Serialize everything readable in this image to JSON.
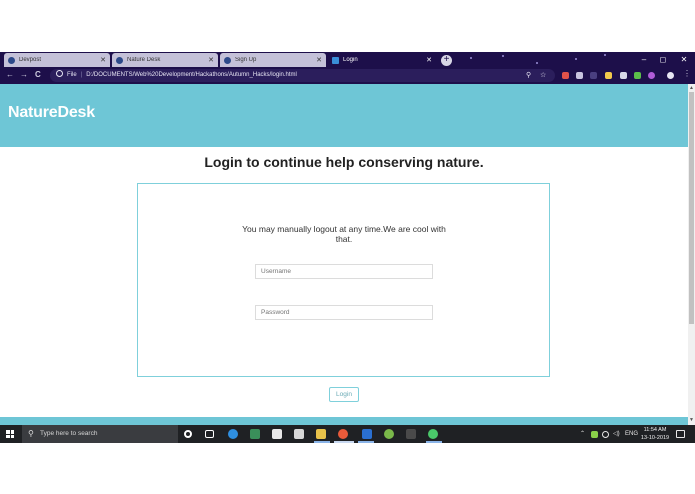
{
  "browser": {
    "tabs": [
      {
        "label": "Devpost",
        "active": false
      },
      {
        "label": "Nature Desk",
        "active": false
      },
      {
        "label": "Sign Up",
        "active": false
      },
      {
        "label": "Login",
        "active": true
      }
    ],
    "new_tab_label": "+",
    "window_controls": {
      "minimize": "–",
      "maximize": "◻",
      "close": "✕"
    },
    "nav": {
      "back": "←",
      "forward": "→",
      "reload": "C"
    },
    "address": {
      "scheme_label": "File",
      "separator": "|",
      "url": "D:/DOCUMENTS/Web%20Development/Hackathons/Autumn_Hacks/login.html"
    }
  },
  "page": {
    "brand": "NatureDesk",
    "headline": "Login to continue help conserving nature.",
    "message": "You may manually logout at any time.We are cool with that.",
    "username": {
      "value": "",
      "placeholder": "Username"
    },
    "password": {
      "value": "",
      "placeholder": "Password"
    },
    "login_label": "Login"
  },
  "taskbar": {
    "search_placeholder": "Type here to search",
    "tray": {
      "language": "ENG"
    },
    "clock": {
      "time": "11:54 AM",
      "date": "13-10-2019"
    }
  },
  "colors": {
    "accent": "#6ec6d6",
    "browser_chrome": "#1d0f4a",
    "taskbar": "#1f2124"
  }
}
